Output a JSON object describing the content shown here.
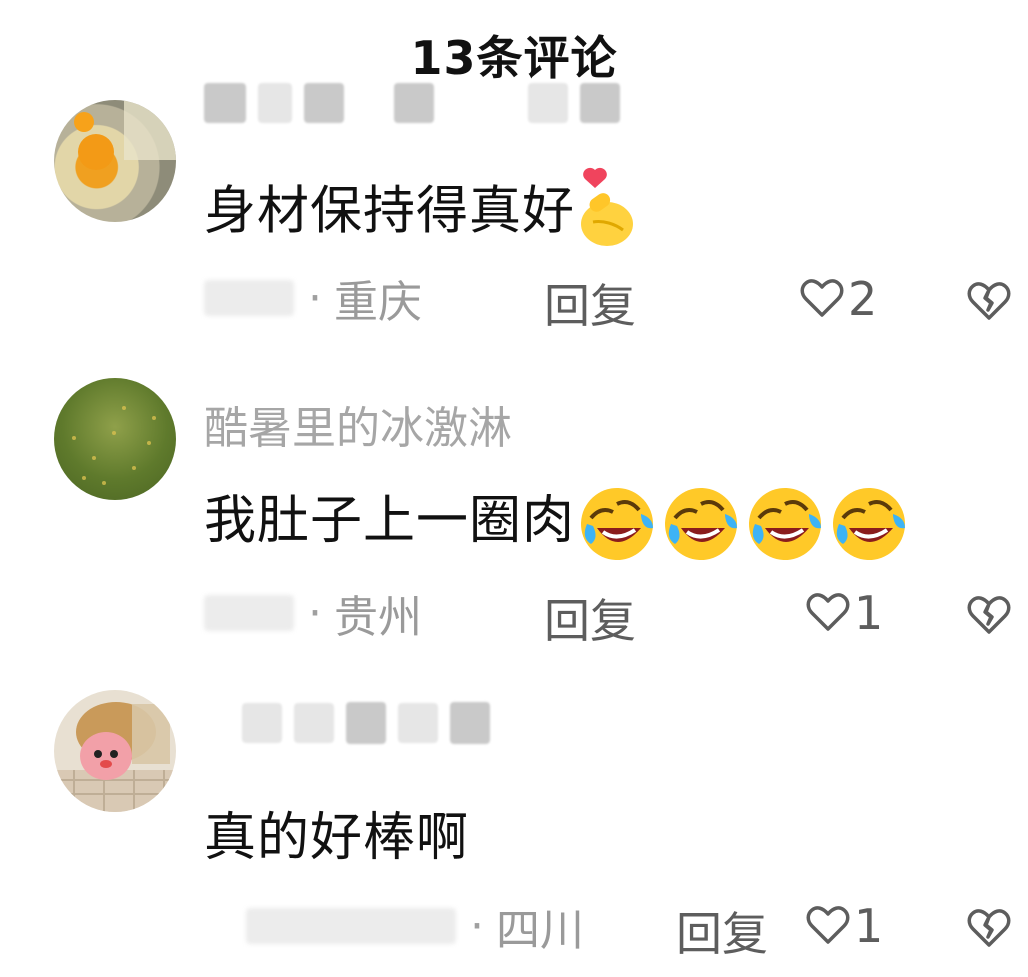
{
  "header": {
    "title": "13条评论"
  },
  "comments": [
    {
      "username": "",
      "text": "身材保持得真好",
      "emoji": "heart-hands-emoji",
      "location": "重庆",
      "reply_label": "回复",
      "likes": "2"
    },
    {
      "username": "酷暑里的冰激淋",
      "text": "我肚子上一圈肉",
      "emoji": "rofl-emoji",
      "location": "贵州",
      "reply_label": "回复",
      "likes": "1"
    },
    {
      "username": "",
      "text": "真的好棒啊",
      "emoji": "",
      "location": "四川",
      "reply_label": "回复",
      "likes": "1"
    }
  ],
  "icons": {
    "like": "heart-outline-icon",
    "dislike": "broken-heart-icon"
  },
  "colors": {
    "text": "#111111",
    "muted": "#9a9a9a",
    "action": "#5d5d5d"
  }
}
